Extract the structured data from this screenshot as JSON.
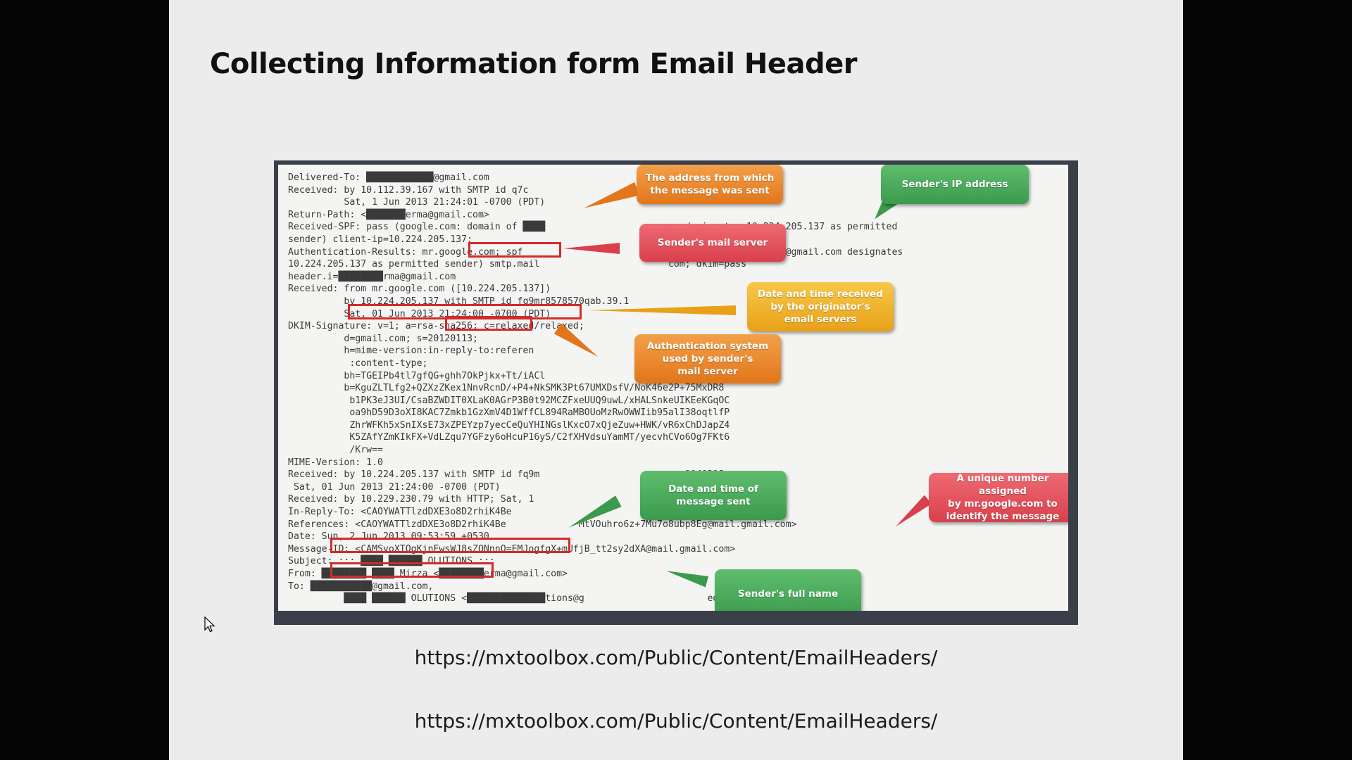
{
  "slide": {
    "title": "Collecting Information form Email Header",
    "urls": [
      "https://mxtoolbox.com/Public/Content/EmailHeaders/",
      "https://mxtoolbox.com/Public/Content/EmailHeaders/"
    ]
  },
  "email_header": {
    "lines": [
      "Delivered-To: ████████████@gmail.com",
      "Received: by 10.112.39.167 with SMTP id q7c",
      "          Sat, 1 Jun 2013 21:24:01 -0700 (PDT)",
      "Return-Path: <███████erma@gmail.com>",
      "Received-SPF: pass (google.com: domain of ████                         designates 10.224.205.137 as permitted",
      "sender) client-ip=10.224.205.137;",
      "Authentication-Results: mr.google.com; spf                            ain of ████████erma@gmail.com designates",
      "10.224.205.137 as permitted sender) smtp.mail                       com; dkim=pass",
      "header.i=████████rma@gmail.com",
      "Received: from mr.google.com ([10.224.205.137])",
      "          by 10.224.205.137 with SMTP id fq9mr8578570qab.39.1                          ps = 1);",
      "          Sat, 01 Jun 2013 21:24:00 -0700 (PDT)",
      "DKIM-Signature: v=1; a=rsa-sha256; c=relaxed/relaxed;",
      "          d=gmail.com; s=20120113;",
      "          h=mime-version:in-reply-to:referen                         bject:from:to",
      "           :content-type;",
      "          bh=TGEIPb4tl7gfQG+ghh7OkPjkx+Tt/iACl",
      "          b=KguZLTLfg2+QZXzZKex1NnvRcnD/+P4+NkSMK3Pt67UMXDsfV/NoK46e2P+75MxDR8",
      "           b1PK3eJ3UI/CsaBZWDIT0XLaK0AGrP3B0t92MCZFxeUUQ9uwL/xHALSnkeUIKEeKGqOC",
      "           oa9hD59D3oXI8KAC7Zmkb1GzXmV4D1WffCL894RaMBOUoMzRwOWWIib95alI38oqtlfP",
      "           ZhrWFKh5xSnIXsE73xZPEYzp7yecCeQuYHINGslKxcO7xQjeZuw+HWK/vR6xChDJapZ4",
      "           K5ZAfYZmKIkFX+VdLZqu7YGFzy6oHcuP16yS/C2fXHVdsuYamMT/yecvhCVo6Og7FKt6",
      "           /Krw==",
      "MIME-Version: 1.0",
      "Received: by 10.224.205.137 with SMTP id fq9m                          1040318;",
      " Sat, 01 Jun 2013 21:24:00 -0700 (PDT)",
      "Received: by 10.229.230.79 with HTTP; Sat, 1                           700 (PDT)",
      "In-Reply-To: <CAOYWATTlzdDXE3o8D2rhiK4Be                               .mail.gmail.com>",
      "References: <CAOYWATTlzdDXE3o8D2rhiK4Be             MtVOuhro6z+7Mu7o8ubp8Eg@mail.gmail.com>",
      "Date: Sun, 2 Jun 2013 09:53:59 +0530",
      "Message-ID: <CAMSvoXTOgKjnFwsWJ8sZQNnnO=EMJogfgX+mUfjB_tt2sy2dXA@mail.gmail.com>",
      "Subject: ::: ████ ██████ OLUTIONS :::",
      "From: ████████ ████ Mirza <████████erma@gmail.com>",
      "To: ███████████@gmail.com,",
      "          ████ ██████ OLUTIONS <██████████████tions@g                      ed <████████_er@yahoo.com>,"
    ]
  },
  "callouts": {
    "address_from": "The address from which\nthe message was sent",
    "sender_ip": "Sender's IP address",
    "mail_server": "Sender's mail server",
    "date_received": "Date and time received\nby the originator's\nemail servers",
    "auth_system": "Authentication system\nused by sender's\nmail server",
    "date_sent": "Date and time of\nmessage sent",
    "unique_number": "A unique number assigned\nby mr.google.com to\nidentify the message",
    "full_name": "Sender's full name"
  },
  "colors": {
    "highlight_box": "#d42a2a",
    "orange": "#e2761a",
    "green": "#3b9a4c",
    "red": "#d9404c",
    "yellow": "#e8a118"
  }
}
